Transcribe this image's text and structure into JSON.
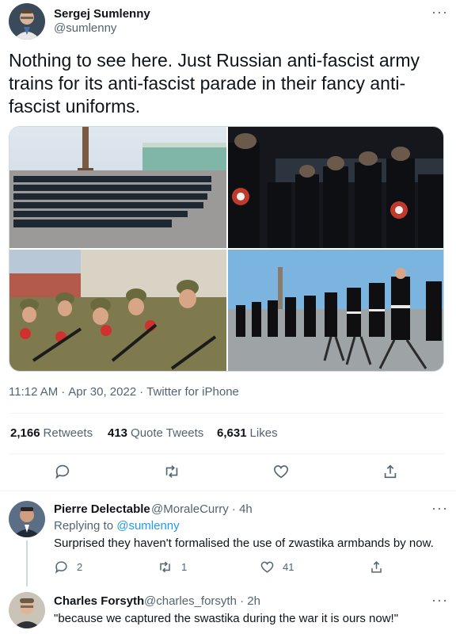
{
  "tweet": {
    "author_name": "Sergej Sumlenny",
    "author_handle": "@sumlenny",
    "text": "Nothing to see here. Just Russian anti-fascist army trains for its anti-fascist parade in their fancy anti-fascist uniforms.",
    "time": "11:12 AM",
    "date": "Apr 30, 2022",
    "client": "Twitter for iPhone",
    "separator": "·",
    "stats": {
      "retweets_count": "2,166",
      "retweets_label": "Retweets",
      "quotes_count": "413",
      "quotes_label": "Quote Tweets",
      "likes_count": "6,631",
      "likes_label": "Likes"
    }
  },
  "media": [
    {
      "icon": "photo-parade-square"
    },
    {
      "icon": "photo-soldiers-night"
    },
    {
      "icon": "photo-soldiers-armbands"
    },
    {
      "icon": "photo-cadets-marching"
    }
  ],
  "replies": [
    {
      "name": "Pierre Delectable",
      "handle": "@MoraleCurry",
      "age": "· 4h",
      "replying_label": "Replying to",
      "replying_to": "@sumlenny",
      "text": "Surprised they haven't formalised the use of zwastika armbands by now.",
      "reply_count": "2",
      "retweet_count": "1",
      "like_count": "41"
    },
    {
      "name": "Charles Forsyth",
      "handle": "@charles_forsyth",
      "age": "· 2h",
      "text": "\"because we captured the swastika during the war it is ours now!\""
    }
  ],
  "colors": {
    "text": "#0f1419",
    "muted": "#536471",
    "link": "#1d9bf0",
    "border": "#eff3f4"
  }
}
